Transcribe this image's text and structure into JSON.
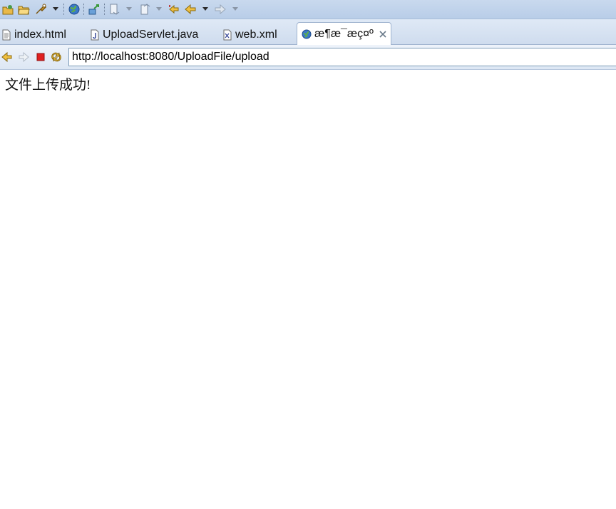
{
  "toolbar": {
    "icons": [
      "open-project-icon",
      "open-folder-icon",
      "run-icon",
      "web-browser-icon",
      "deploy-icon",
      "next-annotation-icon",
      "prev-annotation-icon",
      "last-edit-icon",
      "back-icon",
      "forward-icon"
    ]
  },
  "tabs": [
    {
      "label": "index.html",
      "icon": "html-file-icon"
    },
    {
      "label": "UploadServlet.java",
      "icon": "java-file-icon"
    },
    {
      "label": "web.xml",
      "icon": "xml-file-icon"
    },
    {
      "label": "æ¶æ¯æç¤º",
      "icon": "globe-icon",
      "active": true
    }
  ],
  "navbar": {
    "url": "http://localhost:8080/UploadFile/upload"
  },
  "page": {
    "message": "文件上传成功!"
  },
  "colors": {
    "toolbar_bg": "#c9d9ee",
    "tabstrip_bg": "#dfe9f6",
    "stop_red": "#e02020",
    "arrow_yellow": "#f0c040"
  }
}
